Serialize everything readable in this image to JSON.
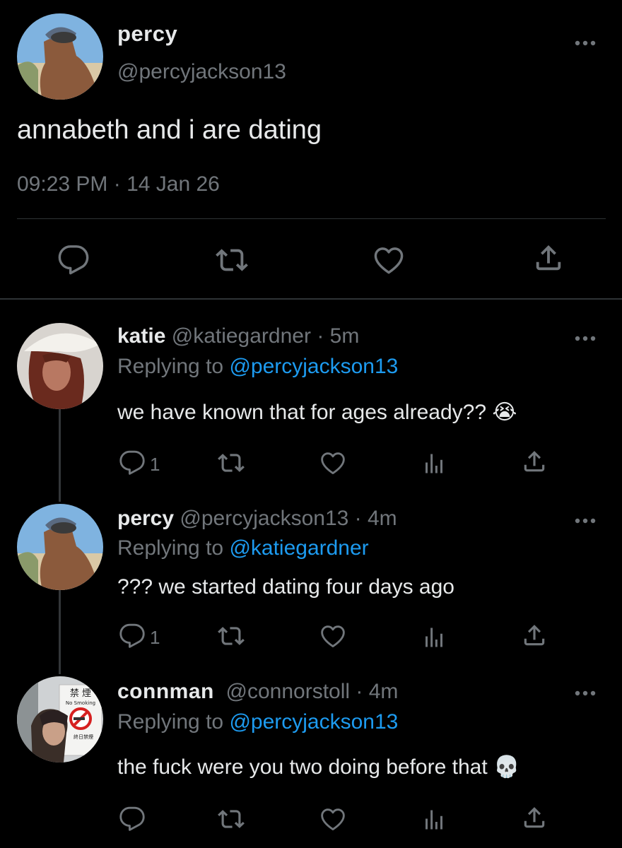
{
  "main_tweet": {
    "display_name": "percy",
    "handle": "@percyjackson13",
    "text": "annabeth and i are dating",
    "timestamp": "09:23 PM · 14 Jan 26",
    "actions": [
      "reply-icon",
      "retweet-icon",
      "like-icon",
      "share-icon"
    ]
  },
  "replies": [
    {
      "display_name": "katie",
      "handle": "@katiegardner",
      "time": "· 5m",
      "replying_to_prefix": "Replying to",
      "replying_to": "@percyjackson13",
      "text": "we have known that for ages already??",
      "emoji": "😭",
      "reply_count": "1"
    },
    {
      "display_name": "percy",
      "handle": "@percyjackson13",
      "time": "· 4m",
      "replying_to_prefix": "Replying to",
      "replying_to": "@katiegardner",
      "text": "??? we started dating four days ago",
      "reply_count": "1"
    },
    {
      "display_name": "connman",
      "handle": "@connorstoll",
      "time": "· 4m",
      "replying_to_prefix": "Replying to",
      "replying_to": "@percyjackson13",
      "text": "the fuck were you two doing before that",
      "emoji": "💀",
      "reply_count": ""
    }
  ],
  "avatar_signs": {
    "top": "禁 煙",
    "sub": "No Smoking",
    "bottom": "終日禁煙"
  },
  "colors": {
    "background": "#000000",
    "text": "#e7e9ea",
    "muted": "#71767b",
    "link": "#1d9bf0",
    "divider": "#2f3336"
  }
}
